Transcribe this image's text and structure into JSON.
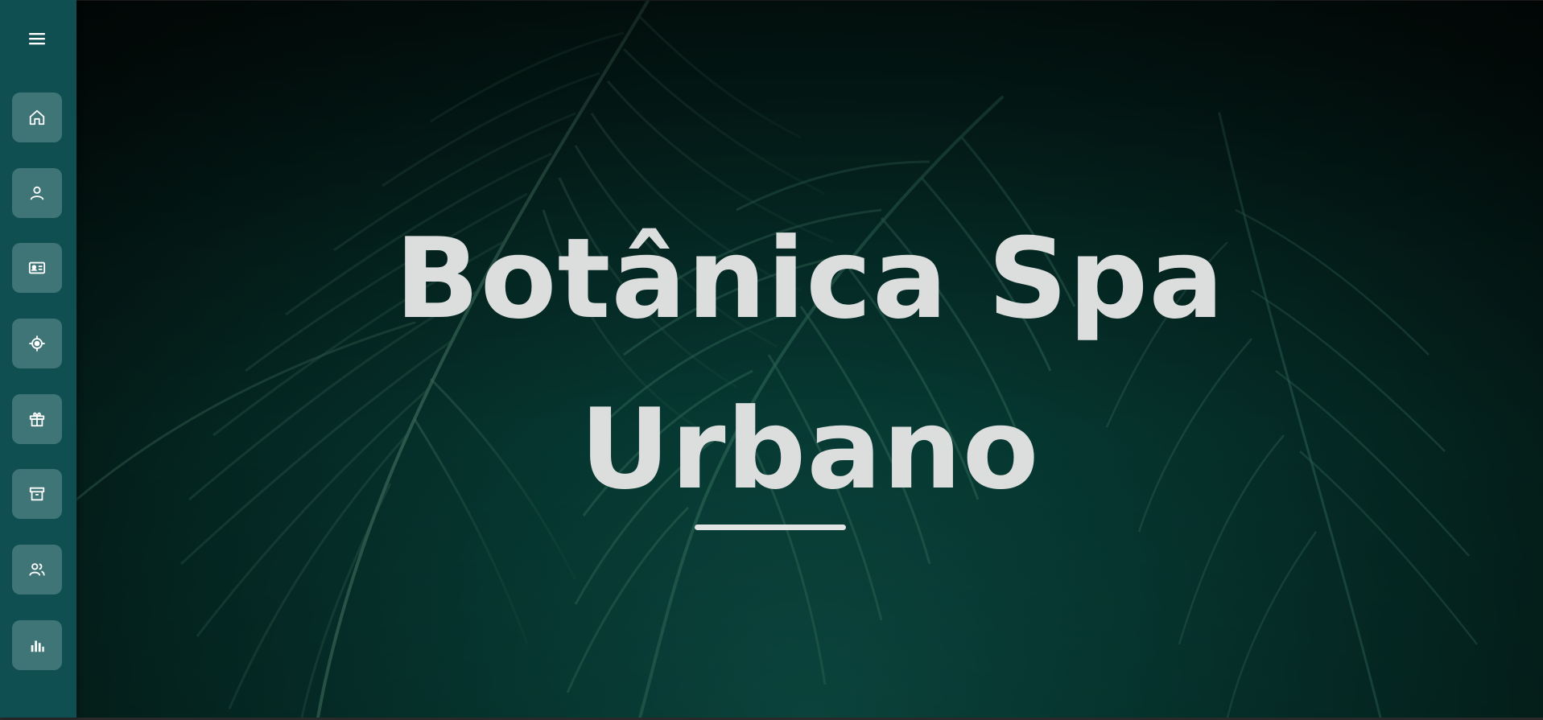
{
  "hero": {
    "title_line1": "Botânica Spa",
    "title_line2": "Urbano"
  },
  "sidebar": {
    "items": [
      {
        "icon": "home-icon"
      },
      {
        "icon": "user-icon"
      },
      {
        "icon": "id-card-icon"
      },
      {
        "icon": "location-target-icon"
      },
      {
        "icon": "gift-icon"
      },
      {
        "icon": "archive-box-icon"
      },
      {
        "icon": "users-icon"
      },
      {
        "icon": "bar-chart-icon"
      }
    ]
  },
  "colors": {
    "sidebar": "#0f4f52",
    "nav_button": "#3f7577",
    "title_text": "#dcdedd"
  }
}
